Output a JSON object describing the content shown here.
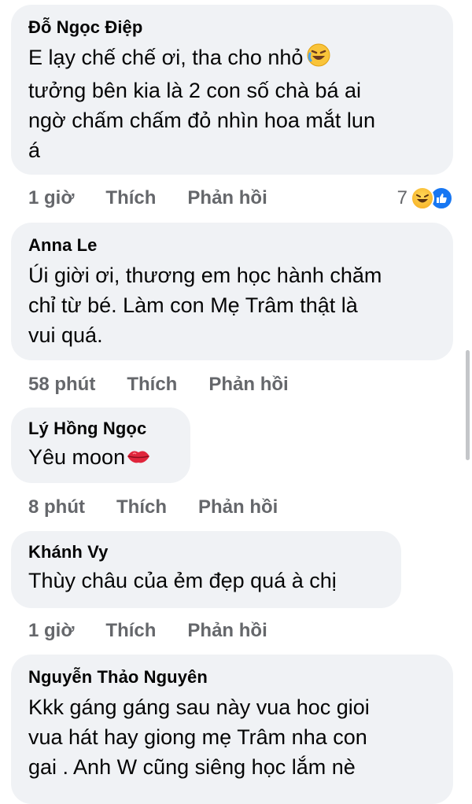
{
  "comments": [
    {
      "author": "Đỗ Ngọc Điệp",
      "text_lines": [
        "E lạy chế chế ơi, tha cho nhỏ",
        "tưởng bên kia là 2 con số chà bá ai",
        "ngờ chấm chấm đỏ nhìn hoa mắt lun",
        "á"
      ],
      "emoji": "rofl-emoji",
      "time": "1 giờ",
      "like_label": "Thích",
      "reply_label": "Phản hồi",
      "reaction_count": "7",
      "reaction_icons": [
        "haha-reaction-icon",
        "like-reaction-icon"
      ]
    },
    {
      "author": "Anna Le",
      "text_lines": [
        "Úi giời ơi, thương em học hành chăm",
        "chỉ từ bé. Làm con Mẹ Trâm thật là",
        "vui quá."
      ],
      "time": "58 phút",
      "like_label": "Thích",
      "reply_label": "Phản hồi"
    },
    {
      "author": "Lý Hồng Ngọc",
      "text_lines": [
        "Yêu moon"
      ],
      "emoji": "kiss-lips-emoji",
      "time": "8 phút",
      "like_label": "Thích",
      "reply_label": "Phản hồi"
    },
    {
      "author": "Khánh Vy",
      "text_lines": [
        "Thùy châu của ẻm đẹp quá à chị"
      ],
      "time": "1 giờ",
      "like_label": "Thích",
      "reply_label": "Phản hồi"
    },
    {
      "author": "Nguyễn Thảo Nguyên",
      "text_lines": [
        "Kkk gáng gáng sau này vua hoc gioi",
        "vua hát hay giong mẹ Trâm nha con",
        "gai . Anh W cũng siêng học lắm nè"
      ]
    }
  ]
}
